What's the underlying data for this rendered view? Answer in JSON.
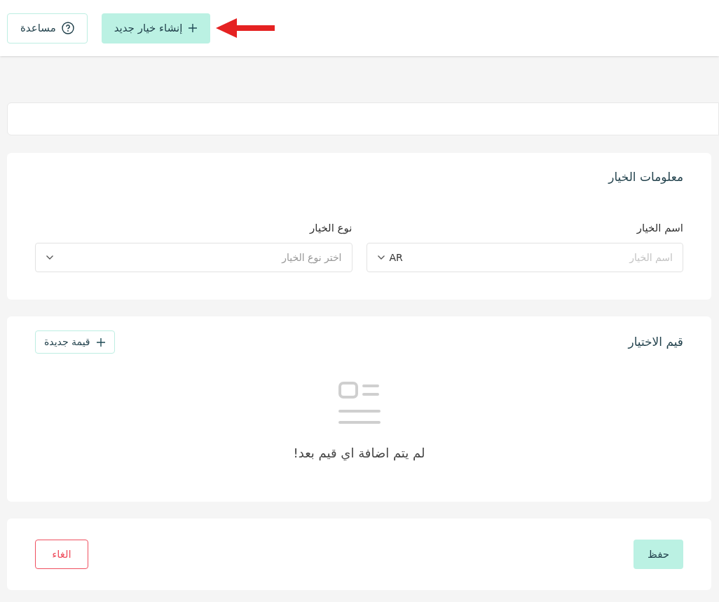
{
  "header": {
    "buttons": [
      {
        "kind": "create",
        "label": "إنشاء خيار جديد"
      },
      {
        "kind": "help",
        "label": "مساعدة"
      }
    ]
  },
  "option_info": {
    "title": "معلومات الخيار",
    "fields": [
      {
        "kind": "text",
        "label": "اسم الخيار",
        "placeholder": "اسم الخيار",
        "language": "AR"
      },
      {
        "kind": "select",
        "label": "نوع الخيار",
        "placeholder": "اختر نوع الخيار"
      }
    ]
  },
  "choice_values": {
    "title": "قيم الاختيار",
    "add_button": "قيمة جديدة",
    "empty_message": "لم يتم اضافة اي قيم بعد!"
  },
  "actions": [
    {
      "kind": "primary",
      "label": "حفظ"
    },
    {
      "kind": "danger",
      "label": "الغاء"
    }
  ]
}
